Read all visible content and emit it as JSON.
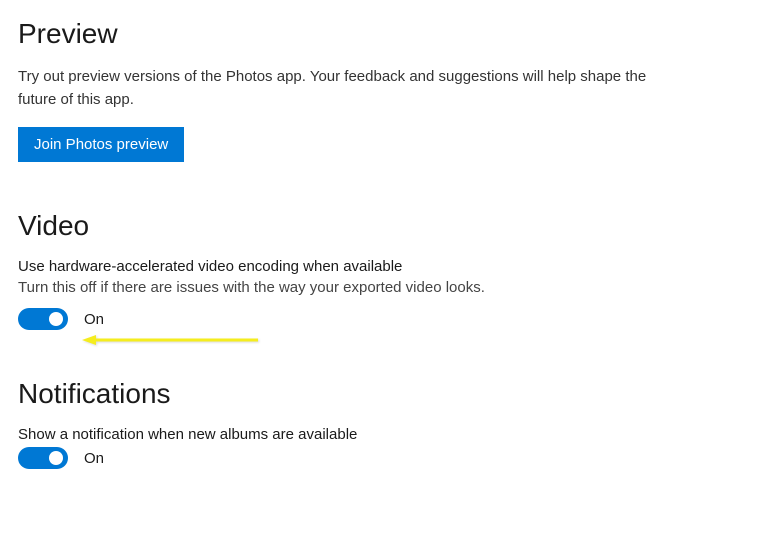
{
  "preview": {
    "title": "Preview",
    "description": "Try out preview versions of the Photos app. Your feedback and suggestions will help shape the future of this app.",
    "button_label": "Join Photos preview"
  },
  "video": {
    "title": "Video",
    "setting_label": "Use hardware-accelerated video encoding when available",
    "setting_hint": "Turn this off if there are issues with the way your exported video looks.",
    "toggle_state": "On"
  },
  "notifications": {
    "title": "Notifications",
    "setting_label": "Show a notification when new albums are available",
    "toggle_state": "On"
  },
  "colors": {
    "accent": "#0078d4",
    "annotation": "#f5ed1e"
  }
}
